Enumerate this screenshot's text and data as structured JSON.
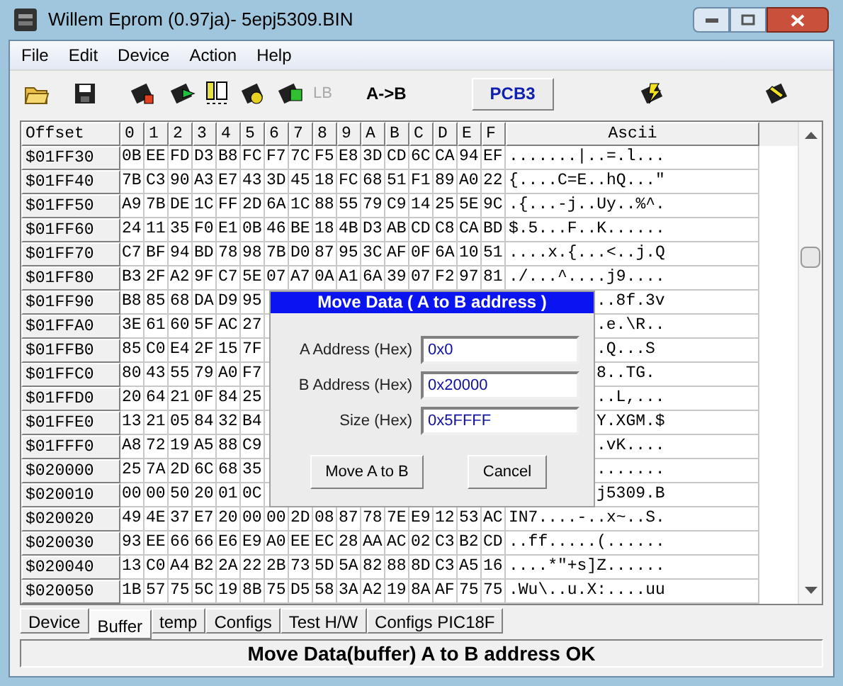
{
  "window": {
    "title": "Willem Eprom (0.97ja)- 5epj5309.BIN"
  },
  "menu": [
    "File",
    "Edit",
    "Device",
    "Action",
    "Help"
  ],
  "toolbar": {
    "lb": {
      "label": "LB",
      "disabled": true
    },
    "ab": "A->B",
    "pcb": "PCB3"
  },
  "table": {
    "columns": [
      "Offset",
      "0",
      "1",
      "2",
      "3",
      "4",
      "5",
      "6",
      "7",
      "8",
      "9",
      "A",
      "B",
      "C",
      "D",
      "E",
      "F",
      "Ascii"
    ],
    "rows": [
      {
        "kind": "full",
        "offset": "$01FF30",
        "bytes": [
          "0B",
          "EE",
          "FD",
          "D3",
          "B8",
          "FC",
          "F7",
          "7C",
          "F5",
          "E8",
          "3D",
          "CD",
          "6C",
          "CA",
          "94",
          "EF"
        ],
        "ascii": ".......|..=.l..."
      },
      {
        "kind": "full",
        "offset": "$01FF40",
        "bytes": [
          "7B",
          "C3",
          "90",
          "A3",
          "E7",
          "43",
          "3D",
          "45",
          "18",
          "FC",
          "68",
          "51",
          "F1",
          "89",
          "A0",
          "22"
        ],
        "ascii": "{....C=E..hQ...\""
      },
      {
        "kind": "full",
        "offset": "$01FF50",
        "bytes": [
          "A9",
          "7B",
          "DE",
          "1C",
          "FF",
          "2D",
          "6A",
          "1C",
          "88",
          "55",
          "79",
          "C9",
          "14",
          "25",
          "5E",
          "9C"
        ],
        "ascii": ".{...-j..Uy..%^."
      },
      {
        "kind": "full",
        "offset": "$01FF60",
        "bytes": [
          "24",
          "11",
          "35",
          "F0",
          "E1",
          "0B",
          "46",
          "BE",
          "18",
          "4B",
          "D3",
          "AB",
          "CD",
          "C8",
          "CA",
          "BD"
        ],
        "ascii": "$.5...F..K......"
      },
      {
        "kind": "full",
        "offset": "$01FF70",
        "bytes": [
          "C7",
          "BF",
          "94",
          "BD",
          "78",
          "98",
          "7B",
          "D0",
          "87",
          "95",
          "3C",
          "AF",
          "0F",
          "6A",
          "10",
          "51"
        ],
        "ascii": "....x.{...<..j.Q"
      },
      {
        "kind": "full",
        "offset": "$01FF80",
        "bytes": [
          "B3",
          "2F",
          "A2",
          "9F",
          "C7",
          "5E",
          "07",
          "A7",
          "0A",
          "A1",
          "6A",
          "39",
          "07",
          "F2",
          "97",
          "81"
        ],
        "ascii": "./...^....j9...."
      },
      {
        "kind": "covered",
        "offset": "$01FF90",
        "bytes": [
          "B8",
          "85",
          "68",
          "DA",
          "D9",
          "95"
        ],
        "ascii": "..8f.3v"
      },
      {
        "kind": "covered",
        "offset": "$01FFA0",
        "bytes": [
          "3E",
          "61",
          "60",
          "5F",
          "AC",
          "27"
        ],
        "ascii": ".e.\\R.."
      },
      {
        "kind": "covered",
        "offset": "$01FFB0",
        "bytes": [
          "85",
          "C0",
          "E4",
          "2F",
          "15",
          "7F"
        ],
        "ascii": ".Q...S"
      },
      {
        "kind": "covered",
        "offset": "$01FFC0",
        "bytes": [
          "80",
          "43",
          "55",
          "79",
          "A0",
          "F7"
        ],
        "ascii": "8..TG."
      },
      {
        "kind": "covered",
        "offset": "$01FFD0",
        "bytes": [
          "20",
          "64",
          "21",
          "0F",
          "84",
          "25"
        ],
        "ascii": "..L,..."
      },
      {
        "kind": "covered",
        "offset": "$01FFE0",
        "bytes": [
          "13",
          "21",
          "05",
          "84",
          "32",
          "B4"
        ],
        "ascii": "Y.XGM.$"
      },
      {
        "kind": "covered",
        "offset": "$01FFF0",
        "bytes": [
          "A8",
          "72",
          "19",
          "A5",
          "88",
          "C9"
        ],
        "ascii": ".vK...."
      },
      {
        "kind": "covered",
        "offset": "$020000",
        "bytes": [
          "25",
          "7A",
          "2D",
          "6C",
          "68",
          "35"
        ],
        "ascii": "......."
      },
      {
        "kind": "covered",
        "offset": "$020010",
        "bytes": [
          "00",
          "00",
          "50",
          "20",
          "01",
          "0C"
        ],
        "ascii": "j5309.B"
      },
      {
        "kind": "full",
        "offset": "$020020",
        "bytes": [
          "49",
          "4E",
          "37",
          "E7",
          "20",
          "00",
          "00",
          "2D",
          "08",
          "87",
          "78",
          "7E",
          "E9",
          "12",
          "53",
          "AC"
        ],
        "ascii": "IN7....-..x~..S."
      },
      {
        "kind": "full",
        "offset": "$020030",
        "bytes": [
          "93",
          "EE",
          "66",
          "66",
          "E6",
          "E9",
          "A0",
          "EE",
          "EC",
          "28",
          "AA",
          "AC",
          "02",
          "C3",
          "B2",
          "CD"
        ],
        "ascii": "..ff.....(......"
      },
      {
        "kind": "full",
        "offset": "$020040",
        "bytes": [
          "13",
          "C0",
          "A4",
          "B2",
          "2A",
          "22",
          "2B",
          "73",
          "5D",
          "5A",
          "82",
          "88",
          "8D",
          "C3",
          "A5",
          "16"
        ],
        "ascii": "....*\"+s]Z......"
      },
      {
        "kind": "full",
        "offset": "$020050",
        "bytes": [
          "1B",
          "57",
          "75",
          "5C",
          "19",
          "8B",
          "75",
          "D5",
          "58",
          "3A",
          "A2",
          "19",
          "8A",
          "AF",
          "75",
          "75"
        ],
        "ascii": ".Wu\\..u.X:....uu"
      }
    ]
  },
  "dialog": {
    "title": "Move Data ( A to B address )",
    "fields": [
      {
        "label": "A Address (Hex)",
        "value": "0x0"
      },
      {
        "label": "B Address (Hex)",
        "value": "0x20000"
      },
      {
        "label": "Size (Hex)",
        "value": "0x5FFFF"
      }
    ],
    "buttons": [
      "Move A to B",
      "Cancel"
    ]
  },
  "tabs": [
    {
      "label": "Device",
      "selected": false
    },
    {
      "label": "Buffer",
      "selected": true
    },
    {
      "label": "temp",
      "selected": false
    },
    {
      "label": "Configs",
      "selected": false
    },
    {
      "label": "Test H/W",
      "selected": false
    },
    {
      "label": "Configs PIC18F",
      "selected": false
    }
  ],
  "status": "Move Data(buffer) A to B address OK"
}
